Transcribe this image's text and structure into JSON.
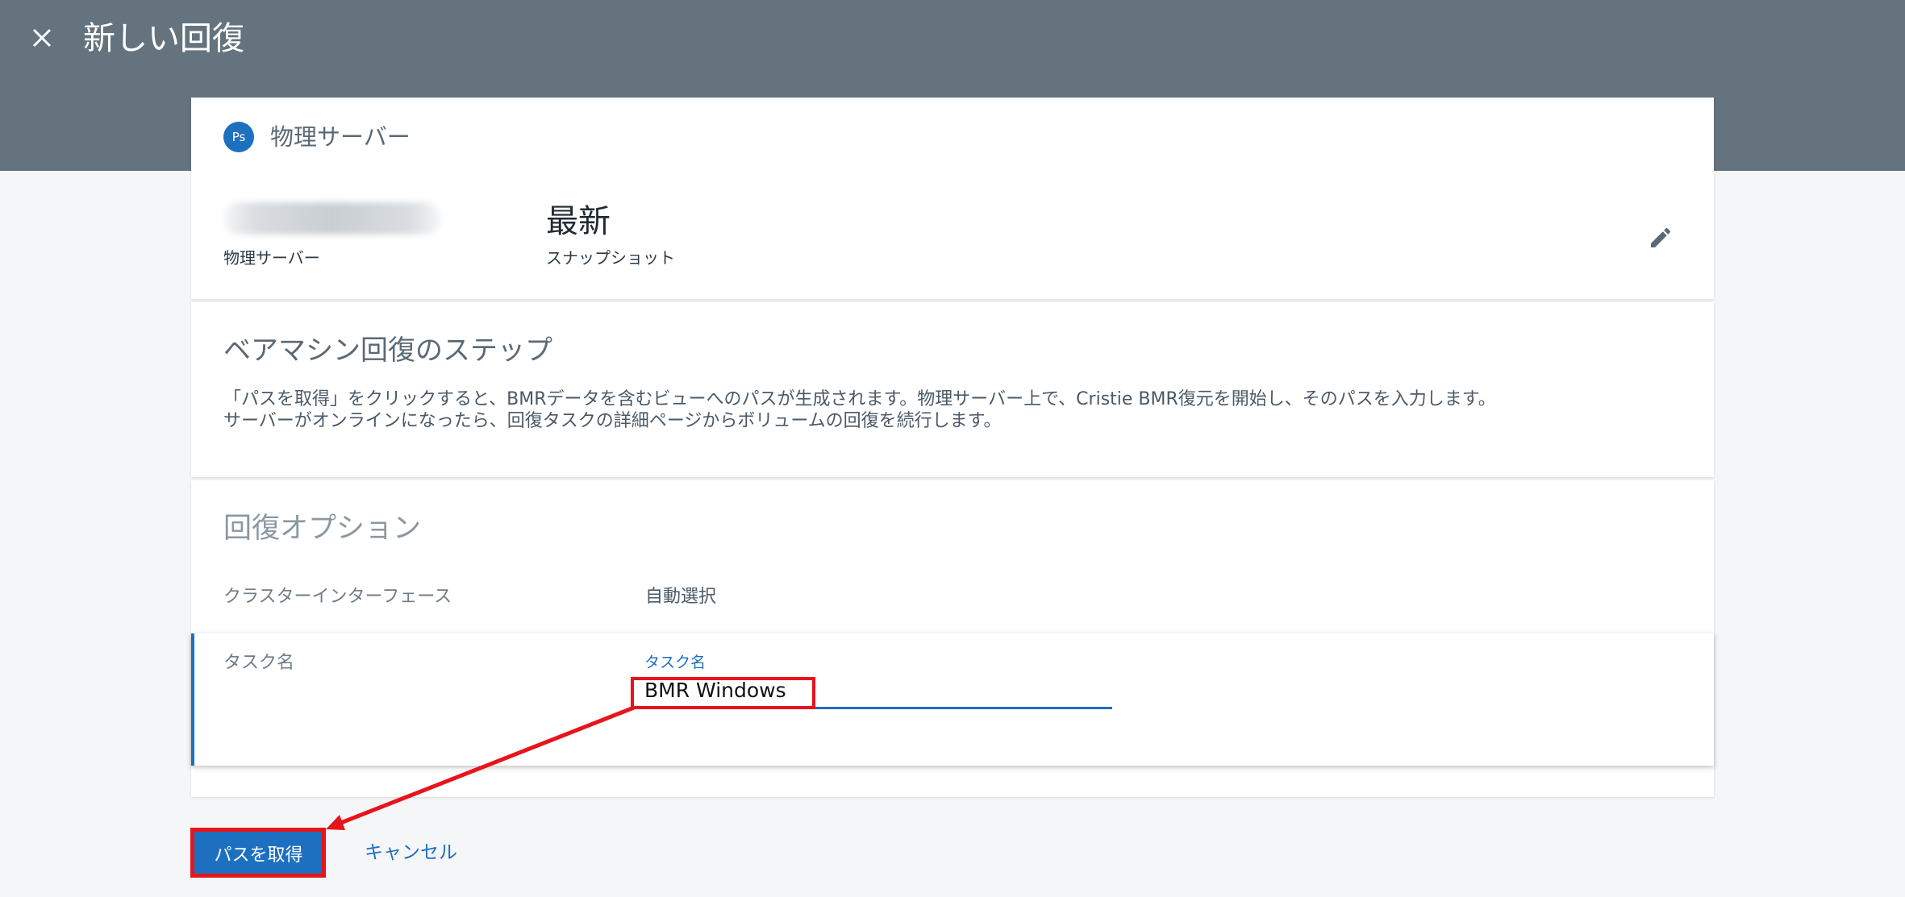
{
  "header": {
    "title": "新しい回復",
    "close_icon": "close-icon",
    "background_color": "#65737e"
  },
  "source_card": {
    "badge": "Ps",
    "heading": "物理サーバー",
    "server_label": "物理サーバー",
    "snapshot_value": "最新",
    "snapshot_label": "スナップショット",
    "edit_icon": "pencil-icon"
  },
  "steps_card": {
    "title": "ベアマシン回復のステップ",
    "line1": "「パスを取得」をクリックすると、BMRデータを含むビューへのパスが生成されます。物理サーバー上で、Cristie BMR復元を開始し、そのパスを入力します。",
    "line2": "サーバーがオンラインになったら、回復タスクの詳細ページからボリュームの回復を続行します。"
  },
  "options_card": {
    "title": "回復オプション",
    "cluster_label": "クラスターインターフェース",
    "cluster_value": "自動選択",
    "task_label": "タスク名",
    "task_field_label": "タスク名",
    "task_value": "BMR Windows"
  },
  "actions": {
    "primary_label": "パスを取得",
    "cancel_label": "キャンセル"
  },
  "colors": {
    "accent": "#1d6fc0",
    "highlight": "#e8141c"
  }
}
